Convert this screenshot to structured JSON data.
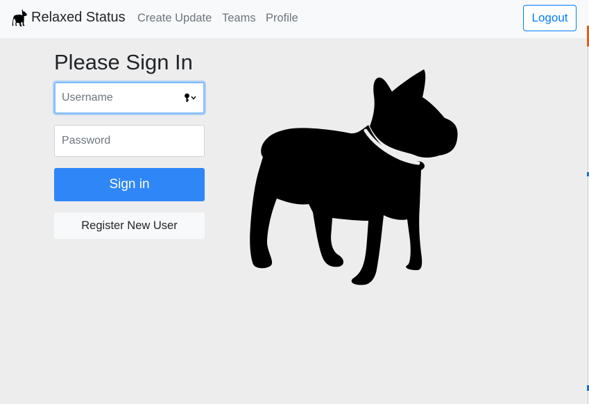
{
  "navbar": {
    "brand": "Relaxed Status",
    "brand_icon": "french-bulldog-icon",
    "links": [
      {
        "label": "Create Update"
      },
      {
        "label": "Teams"
      },
      {
        "label": "Profile"
      }
    ],
    "logout_label": "Logout"
  },
  "signin": {
    "heading": "Please Sign In",
    "username": {
      "value": "",
      "placeholder": "Username"
    },
    "password": {
      "value": "",
      "placeholder": "Password"
    },
    "autofill_icon": "key-dropdown-icon",
    "submit_label": "Sign in",
    "register_label": "Register New User"
  },
  "hero_image": "french-bulldog-silhouette",
  "colors": {
    "primary": "#2f86f6",
    "outline_primary": "#007bff",
    "navbar_bg": "#f8f9fa",
    "page_bg": "#ededed",
    "focus_ring": "#80bdff"
  }
}
